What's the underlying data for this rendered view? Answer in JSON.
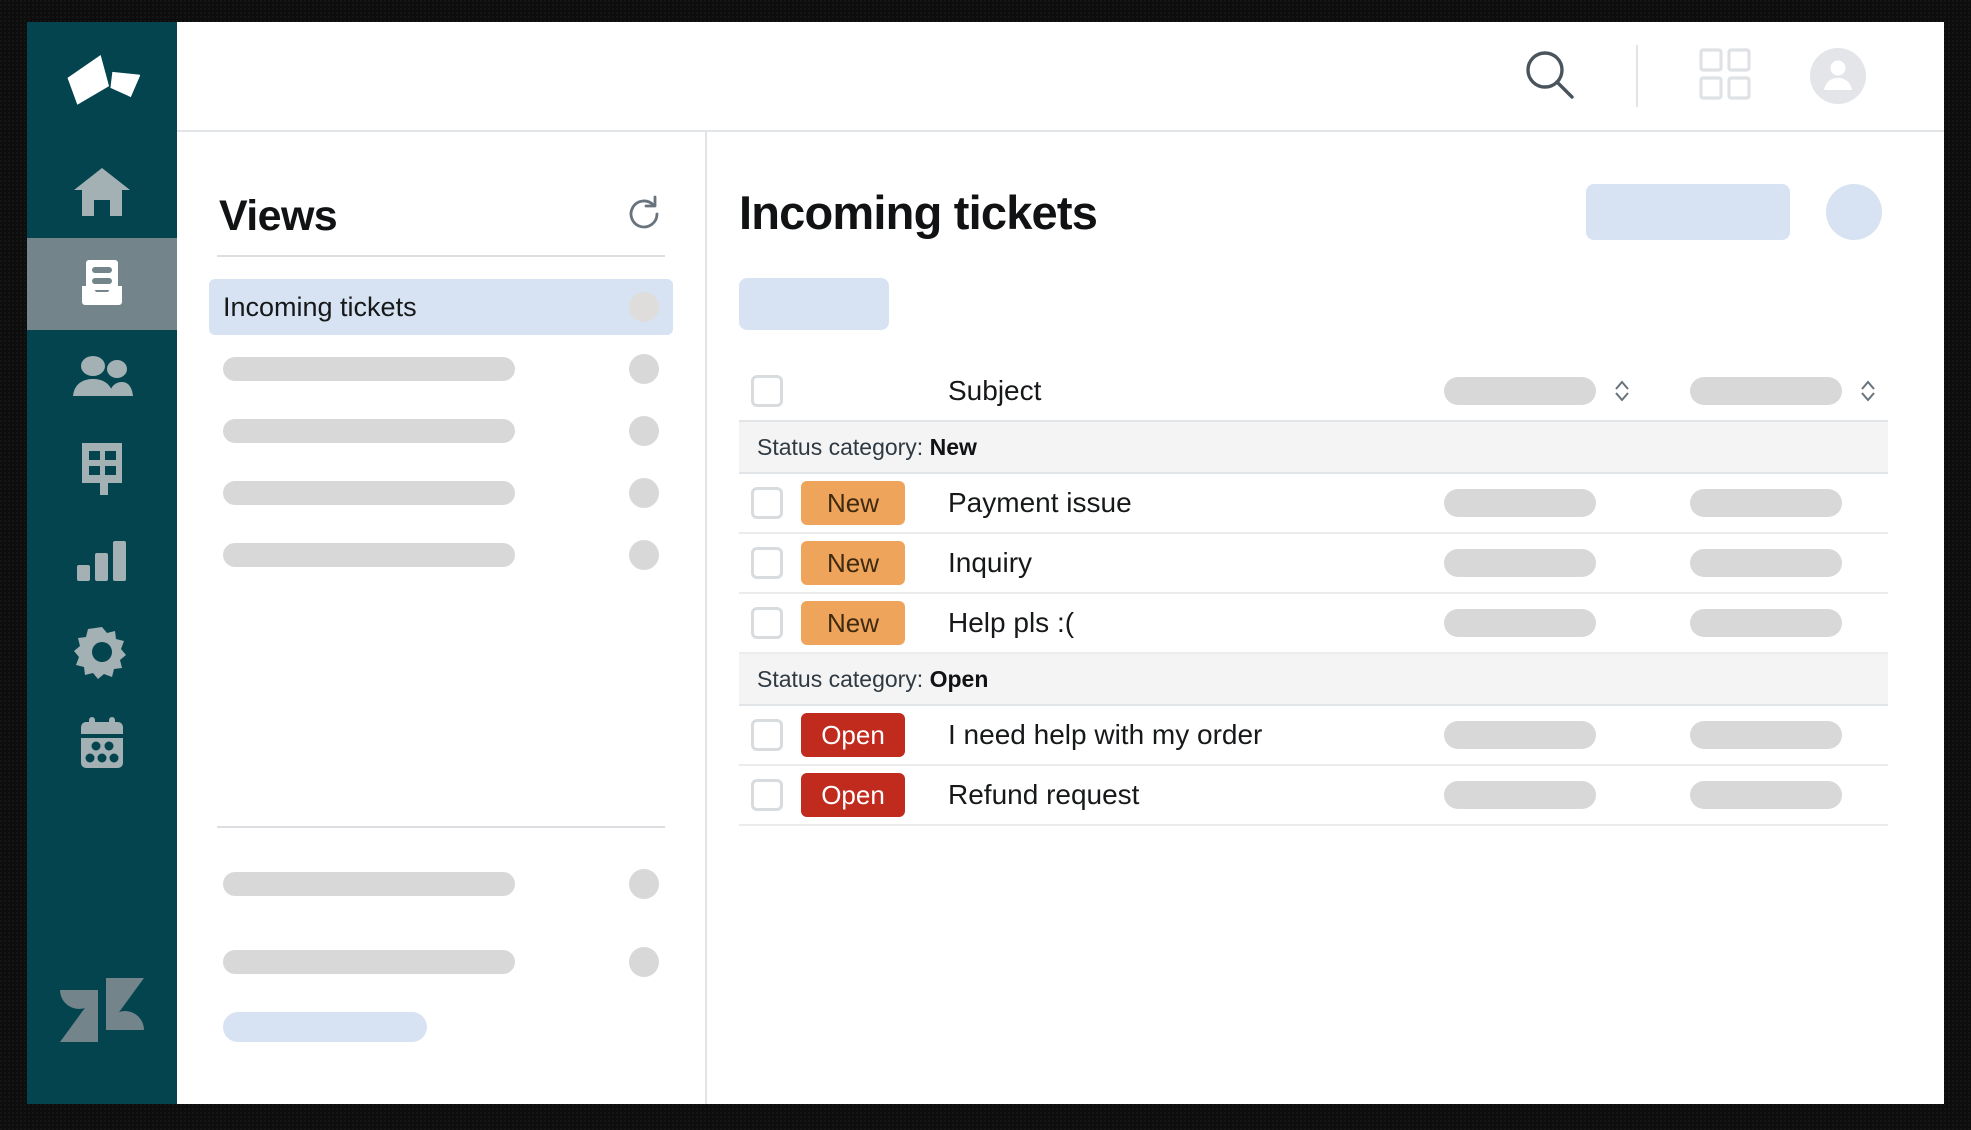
{
  "app": {
    "brand_logo": "zendesk-mark",
    "rail_bg": "#03444E",
    "rail_active_bg": "#73858B"
  },
  "topbar": {
    "search_icon": "search-icon",
    "apps_icon": "apps-grid-icon",
    "avatar_icon": "user-avatar-icon"
  },
  "rail": {
    "items": [
      {
        "name": "home-icon"
      },
      {
        "name": "views-tray-icon",
        "active": true
      },
      {
        "name": "customers-people-icon"
      },
      {
        "name": "organizations-building-icon"
      },
      {
        "name": "reporting-bar-chart-icon"
      },
      {
        "name": "admin-gear-icon"
      },
      {
        "name": "calendar-icon"
      }
    ],
    "footer_logo": "zendesk-logo"
  },
  "views": {
    "title": "Views",
    "refresh_icon": "refresh-icon",
    "selected_item": "Incoming tickets",
    "placeholder_rows": 4,
    "footer_placeholder_rows": 2
  },
  "main": {
    "title": "Incoming tickets",
    "table": {
      "columns": [
        "",
        "",
        "Subject",
        "",
        ""
      ],
      "subject_header": "Subject",
      "group_label_prefix": "Status category:",
      "groups": [
        {
          "label": "New",
          "rows": [
            {
              "status": "New",
              "status_kind": "new",
              "subject": "Payment issue"
            },
            {
              "status": "New",
              "status_kind": "new",
              "subject": "Inquiry"
            },
            {
              "status": "New",
              "status_kind": "new",
              "subject": "Help pls :("
            }
          ]
        },
        {
          "label": "Open",
          "rows": [
            {
              "status": "Open",
              "status_kind": "open",
              "subject": "I need help with my order"
            },
            {
              "status": "Open",
              "status_kind": "open",
              "subject": "Refund request"
            }
          ]
        }
      ]
    }
  },
  "colors": {
    "brand_teal": "#03444E",
    "badge_new": "#EFA45C",
    "badge_open": "#C02B1D",
    "highlight_blue": "#d7e3f2",
    "skeleton_gray": "#d8d8d8"
  }
}
